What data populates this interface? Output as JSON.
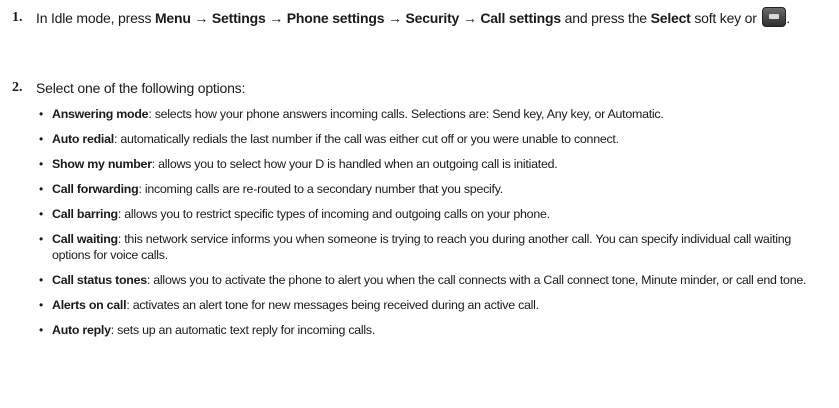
{
  "steps": [
    {
      "number": "1.",
      "parts": {
        "a": "In Idle mode, press ",
        "b_menu": "Menu",
        "arrow1": " → ",
        "b_settings": "Settings",
        "arrow2": " → ",
        "b_phone": "Phone settings",
        "arrow3": " → ",
        "b_security": "Security",
        "arrow4": " → ",
        "b_call": "Call settings",
        "c": " and press the ",
        "b_select": "Select",
        "d": " soft key or ",
        "e": "."
      },
      "ok_key_icon": "ok-key-icon"
    },
    {
      "number": "2.",
      "text": "Select one of the following options:"
    }
  ],
  "options": [
    {
      "term": "Answering mode",
      "desc": ": selects how your phone answers incoming calls. Selections are: Send key, Any key, or Automatic."
    },
    {
      "term": "Auto redial",
      "desc": ": automatically redials the last number if the call was either cut off or you were unable to connect."
    },
    {
      "term": "Show my number",
      "desc": ": allows you to select how your  D is handled when an outgoing call is initiated."
    },
    {
      "term": "Call forwarding",
      "desc": ": incoming calls are re-routed to a secondary number that you specify."
    },
    {
      "term": "Call barring",
      "desc": ": allows you to restrict specific types of incoming and outgoing calls on your phone."
    },
    {
      "term": "Call waiting",
      "desc": ": this network service informs you when someone is trying to reach you during another call. You can specify individual call waiting options for voice calls."
    },
    {
      "term": "Call status tones",
      "desc": ": allows you to activate the phone to alert you when the call connects with a Call connect tone, Minute minder, or call end tone."
    },
    {
      "term": "Alerts on call",
      "desc": ": activates an alert tone for new messages being received during an active call."
    },
    {
      "term": "Auto reply",
      "desc": ": sets up an automatic text reply for incoming calls."
    }
  ]
}
